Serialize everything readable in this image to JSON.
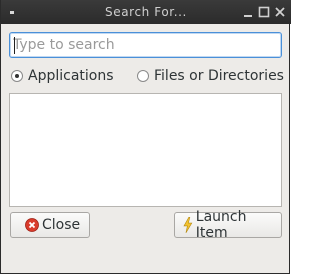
{
  "window": {
    "title": "Search For..."
  },
  "search": {
    "placeholder": "Type to search",
    "value": ""
  },
  "scope": {
    "options": [
      "Applications",
      "Files or Directories"
    ],
    "selected": "Applications"
  },
  "results": [],
  "buttons": {
    "close_label": "Close",
    "launch_label": "Launch Item"
  },
  "icons": {
    "window_menu": "window-menu-icon",
    "minimize": "minimize-icon",
    "maximize": "maximize-icon",
    "close": "close-icon",
    "close_button": "red-close-circle-icon",
    "launch_button": "lightning-bolt-icon"
  },
  "colors": {
    "titlebar": "#2b2b2b",
    "focus_border": "#4a90d9",
    "window_bg": "#edebe8",
    "close_icon": "#d93b2b",
    "launch_icon": "#f2c230"
  }
}
